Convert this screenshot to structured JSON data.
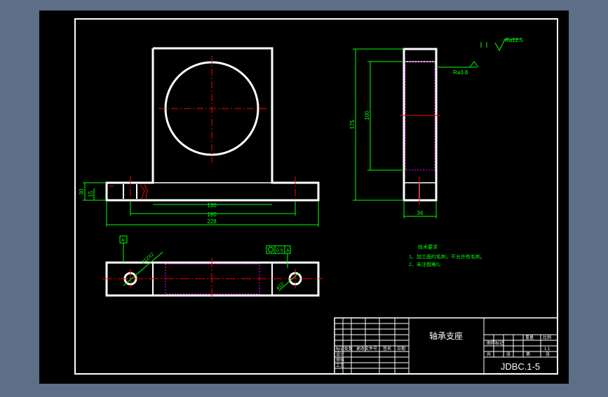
{
  "colors": {
    "background": "#5c6f86",
    "sheet": "#000000",
    "outline": "#ffffff",
    "dimension": "#00ff00",
    "centerline": "#ff0000",
    "hidden": "#ff00ff"
  },
  "dimensions": {
    "d130": "130",
    "d180": "180",
    "d228": "228",
    "d30": "30",
    "d15": "15",
    "d175": "175",
    "d100": "100",
    "d36": "36"
  },
  "annotations": {
    "datum_a": "A",
    "hole_callout": "ø12X2",
    "hole_small": "ø12",
    "position_tolerance": "0.5",
    "position_datum": "A",
    "roughness_general": "Ra12.5",
    "roughness_bore": "Ra3.8",
    "tech_req_title": "技术要求",
    "tech_req_1": "1、加工面的毛刺，不允许有毛刺。",
    "tech_req_2": "2、未注倒角0。"
  },
  "title_block": {
    "part_name": "轴承支座",
    "drawing_number": "JDBC.1-5",
    "row_labels": [
      "标记",
      "设计",
      "审核",
      "工艺"
    ],
    "col_labels": [
      "处数",
      "更改文件号",
      "签名",
      "日期"
    ],
    "right_labels": [
      "图样标记",
      "重量",
      "比例"
    ],
    "scale": "1:1",
    "sheet_info": [
      "共",
      "张",
      "第",
      "张"
    ]
  }
}
